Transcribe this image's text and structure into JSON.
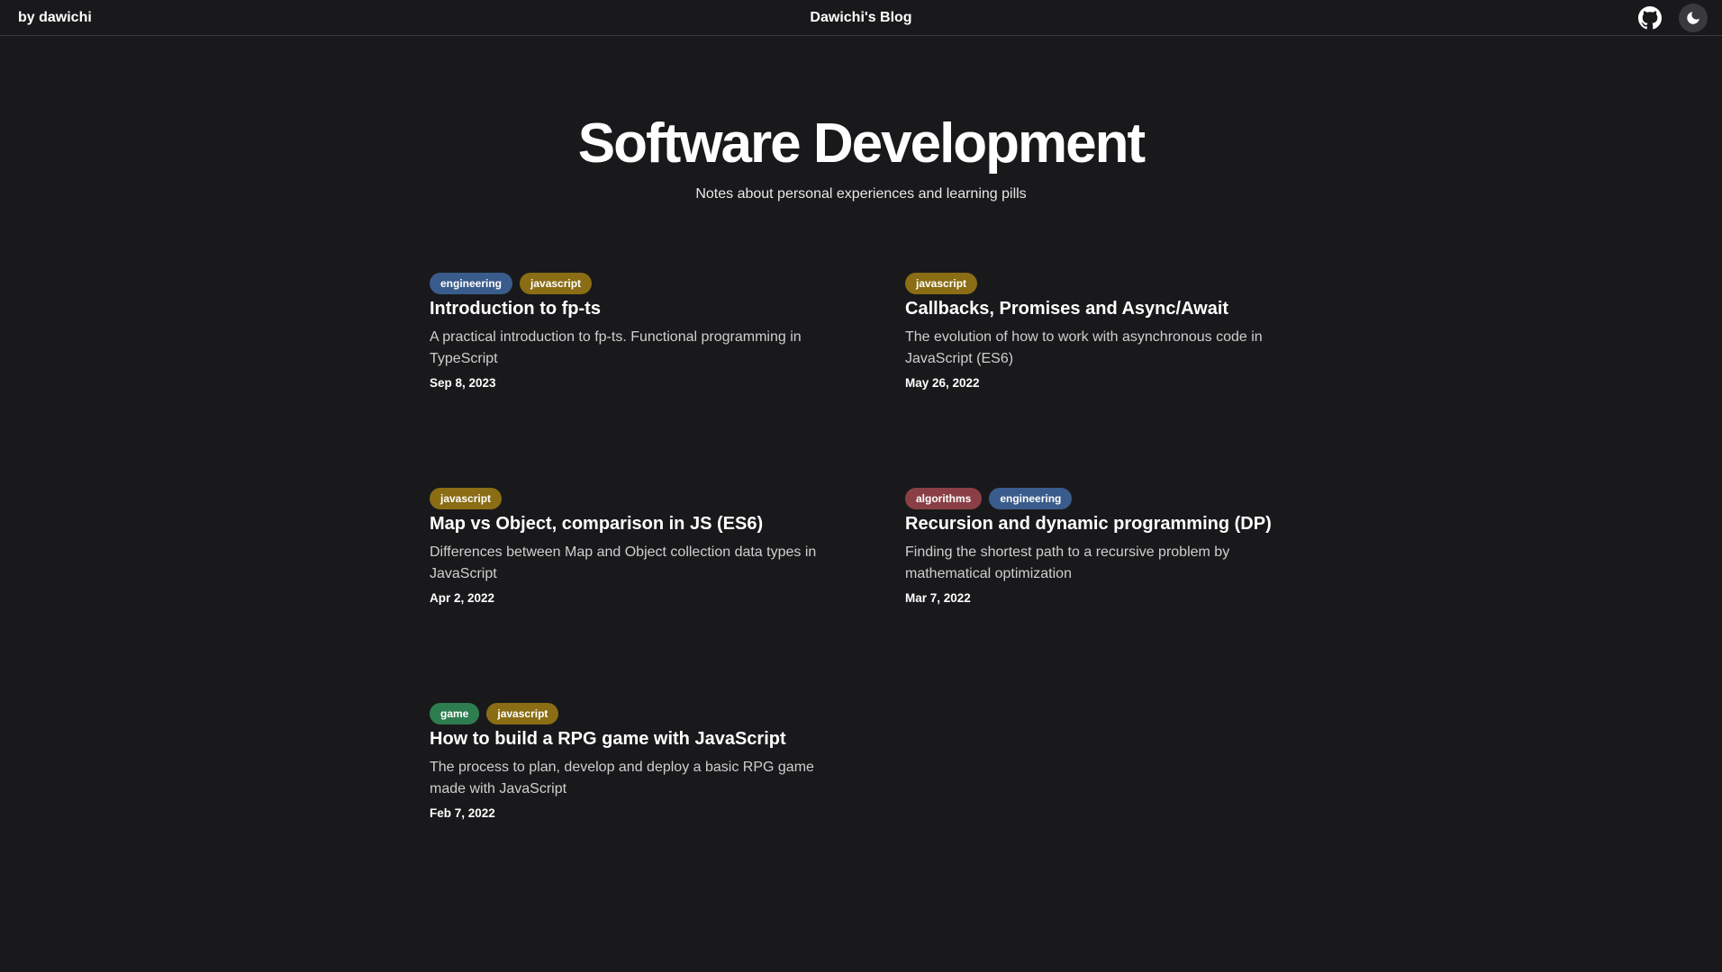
{
  "header": {
    "author": "by dawichi",
    "title": "Dawichi's Blog",
    "github_icon": "github-icon",
    "theme_icon": "moon-icon"
  },
  "hero": {
    "title": "Software Development",
    "subtitle": "Notes about personal experiences and learning pills"
  },
  "colors": {
    "background": "#19191b",
    "tag_engineering": "#3a5c8c",
    "tag_javascript": "#8a6d14",
    "tag_algorithms": "#8a3f46",
    "tag_game": "#2e7d4f"
  },
  "posts": [
    {
      "tags": [
        {
          "label": "engineering",
          "color": "#3a5c8c"
        },
        {
          "label": "javascript",
          "color": "#8a6d14"
        }
      ],
      "title": "Introduction to fp-ts",
      "description": "A practical introduction to fp-ts. Functional programming in TypeScript",
      "date": "Sep 8, 2023"
    },
    {
      "tags": [
        {
          "label": "javascript",
          "color": "#8a6d14"
        }
      ],
      "title": "Callbacks, Promises and Async/Await",
      "description": "The evolution of how to work with asynchronous code in JavaScript (ES6)",
      "date": "May 26, 2022"
    },
    {
      "tags": [
        {
          "label": "javascript",
          "color": "#8a6d14"
        }
      ],
      "title": "Map vs Object, comparison in JS (ES6)",
      "description": "Differences between Map and Object collection data types in JavaScript",
      "date": "Apr 2, 2022"
    },
    {
      "tags": [
        {
          "label": "algorithms",
          "color": "#8a3f46"
        },
        {
          "label": "engineering",
          "color": "#3a5c8c"
        }
      ],
      "title": "Recursion and dynamic programming (DP)",
      "description": "Finding the shortest path to a recursive problem by mathematical optimization",
      "date": "Mar 7, 2022"
    },
    {
      "tags": [
        {
          "label": "game",
          "color": "#2e7d4f"
        },
        {
          "label": "javascript",
          "color": "#8a6d14"
        }
      ],
      "title": "How to build a RPG game with JavaScript",
      "description": "The process to plan, develop and deploy a basic RPG game made with JavaScript",
      "date": "Feb 7, 2022"
    }
  ]
}
